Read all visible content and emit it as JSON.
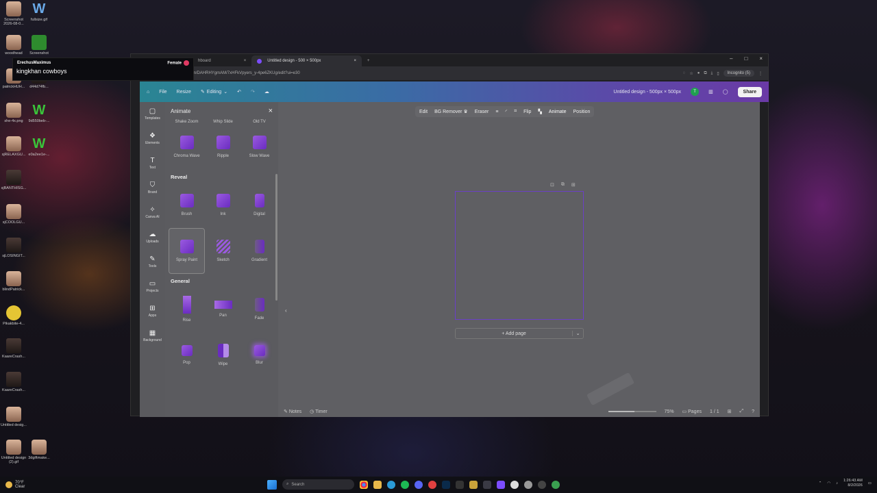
{
  "desktop": {
    "icons": [
      {
        "label": "Screenshot 2026-08-0...",
        "kind": "face"
      },
      {
        "label": "fullsize.gif",
        "kind": "w2"
      },
      {
        "label": "woodhead",
        "kind": "face"
      },
      {
        "label": "Screenshot",
        "kind": "g"
      },
      {
        "label": "patrickHUH...",
        "kind": "face"
      },
      {
        "label": "d44d74fb...",
        "kind": "dark"
      },
      {
        "label": "she-4x.png",
        "kind": "face"
      },
      {
        "label": "9d550beb-...",
        "kind": "w"
      },
      {
        "label": "sjRELAXGU...",
        "kind": "face"
      },
      {
        "label": "e0a2ee1e-...",
        "kind": "w"
      },
      {
        "label": "sjBANTHISG...",
        "kind": "dark"
      },
      {
        "label": "sjCOOLGU...",
        "kind": "face"
      },
      {
        "label": "sjLOSINGIT...",
        "kind": "dark"
      },
      {
        "label": "blindPatrick...",
        "kind": "face"
      },
      {
        "label": "Pikakbite-4...",
        "kind": "pika"
      },
      {
        "label": "KaareCrash...",
        "kind": "dark"
      },
      {
        "label": "KaareCrash...",
        "kind": "dark"
      },
      {
        "label": "Untitled desig...",
        "kind": "face"
      },
      {
        "label": "Untitled design (2).gif",
        "kind": "face"
      },
      {
        "label": "3dgiftmake...",
        "kind": "face"
      }
    ]
  },
  "stream_overlay": {
    "username": "ErechusMaximus",
    "gender": "Female",
    "message": "kingkhan cowboys"
  },
  "browser": {
    "tabs": [
      {
        "title": "hboard"
      },
      {
        "title": "Untitled design - 500 × 500px"
      }
    ],
    "new_tab": "+",
    "url": "canva.com/design/DAHRHYgmAM/7xHFkVpyers_y-4pe6ZKUg/edit?ui=e30",
    "incognito_label": "Incognito (5)",
    "window_controls": [
      "–",
      "□",
      "×"
    ]
  },
  "canva_header": {
    "home": "⌂",
    "file": "File",
    "resize": "Resize",
    "mode": "Editing",
    "title": "Untitled design - 500px × 500px",
    "avatar_initial": "T",
    "share": "Share"
  },
  "rail": [
    {
      "label": "Templates",
      "icon": "▢"
    },
    {
      "label": "Elements",
      "icon": "❖"
    },
    {
      "label": "Text",
      "icon": "T"
    },
    {
      "label": "Brand",
      "icon": "⛉"
    },
    {
      "label": "Canva AI",
      "icon": "✧"
    },
    {
      "label": "Uploads",
      "icon": "☁"
    },
    {
      "label": "Tools",
      "icon": "✎"
    },
    {
      "label": "Projects",
      "icon": "▭"
    },
    {
      "label": "Apps",
      "icon": "⊞"
    },
    {
      "label": "Background",
      "icon": "▦"
    }
  ],
  "animate_panel": {
    "title": "Animate",
    "close": "×",
    "top_labels": [
      "Shake Zoom",
      "Whip Slide",
      "Old TV"
    ],
    "row1": [
      "Chroma Wave",
      "Ripple",
      "Slow Wave"
    ],
    "sections": [
      {
        "name": "Reveal",
        "items": [
          "Brush",
          "Ink",
          "Digital",
          "Spray Paint",
          "Sketch",
          "Gradient"
        ],
        "selected": "Spray Paint"
      },
      {
        "name": "General",
        "items": [
          "Rise",
          "Pan",
          "Fade",
          "Pop",
          "Wipe",
          "Blur"
        ]
      }
    ]
  },
  "context_toolbar": [
    "Edit",
    "BG Remover",
    "Eraser",
    "Flip",
    "Animate",
    "Position"
  ],
  "canvas": {
    "add_page": "+ Add page",
    "dropdown": "⌄"
  },
  "bottom_bar": {
    "notes": "Notes",
    "timer": "Timer",
    "zoom": "75%",
    "zoom_fraction": 0.55,
    "pages_label": "Pages",
    "page_count": "1 / 1"
  },
  "taskbar": {
    "temp": "70°F",
    "weather": "Clear",
    "search": "Search",
    "time": "1:26:43 AM",
    "date": "8/2/2026"
  }
}
